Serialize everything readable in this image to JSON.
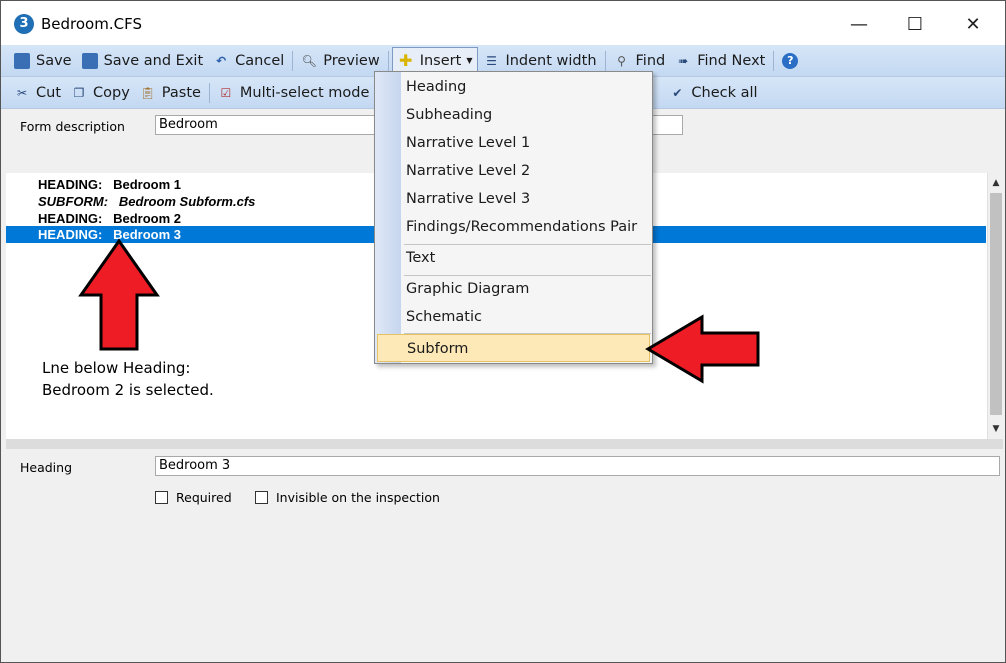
{
  "window": {
    "title": "Bedroom.CFS",
    "minimize_glyph": "—",
    "maximize_glyph": "☐",
    "close_glyph": "✕"
  },
  "toolbar1": {
    "save": "Save",
    "save_and_exit": "Save and Exit",
    "cancel": "Cancel",
    "preview": "Preview",
    "insert": "Insert",
    "indent_width": "Indent width",
    "find": "Find",
    "find_next": "Find Next",
    "help_glyph": "?"
  },
  "toolbar2": {
    "cut": "Cut",
    "copy": "Copy",
    "paste": "Paste",
    "multi_select_mode": "Multi-select mode",
    "check_all": "Check all"
  },
  "form_description": {
    "label": "Form description",
    "value": "Bedroom"
  },
  "tree_rows": [
    {
      "text": "HEADING:   Bedroom 1",
      "style": "normal",
      "selected": false
    },
    {
      "text": "SUBFORM:   Bedroom Subform.cfs",
      "style": "italic",
      "selected": false
    },
    {
      "text": "HEADING:   Bedroom 2",
      "style": "normal",
      "selected": false
    },
    {
      "text": "HEADING:   Bedroom 3",
      "style": "normal",
      "selected": true
    }
  ],
  "annotation": {
    "line1": "Lne below Heading:",
    "line2": "Bedroom 2 is selected."
  },
  "insert_menu": {
    "items": [
      "Heading",
      "Subheading",
      "Narrative Level 1",
      "Narrative Level 2",
      "Narrative Level 3",
      "Findings/Recommendations Pair",
      "Text",
      "Graphic Diagram",
      "Schematic",
      "Subform"
    ],
    "highlighted": "Subform"
  },
  "heading_field": {
    "label": "Heading",
    "value": "Bedroom 3"
  },
  "checkboxes": {
    "required": "Required",
    "invisible": "Invisible on the inspection"
  },
  "colors": {
    "selection": "#0078d7",
    "toolbar": "#c9dcf4",
    "menu_highlight": "#fde9b8",
    "arrow_red": "#ee1c25"
  }
}
